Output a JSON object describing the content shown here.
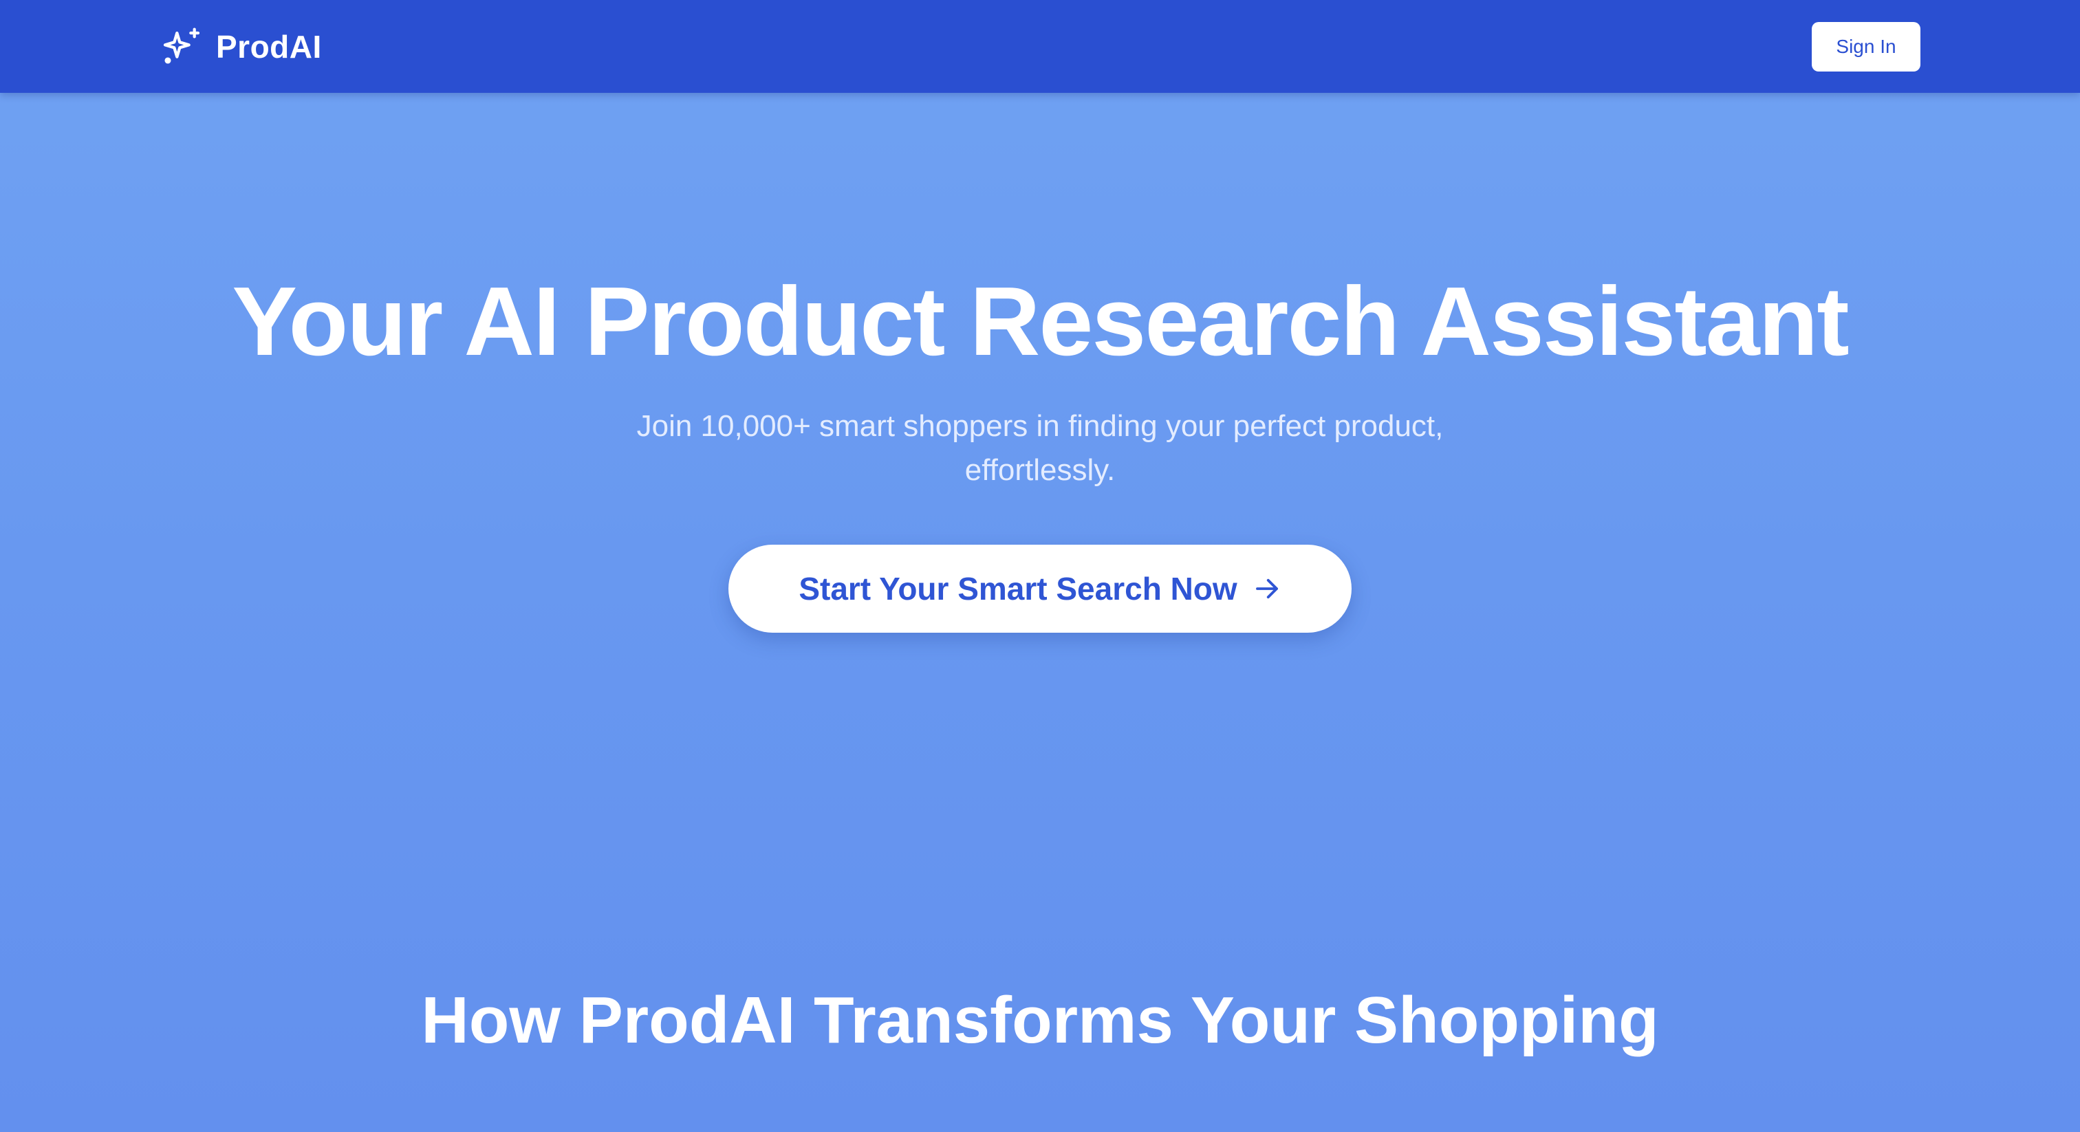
{
  "navbar": {
    "brand_icon": "sparkles-icon",
    "brand_name": "ProdAI",
    "signin_label": "Sign In",
    "background_color": "#2a4fd1"
  },
  "hero": {
    "title": "Your AI Product Research Assistant",
    "subtitle_line1": "Join 10,000+ smart shoppers in finding your perfect product,",
    "subtitle_line2": "effortlessly.",
    "cta_label": "Start Your Smart Search Now",
    "cta_icon": "arrow-right-icon"
  },
  "features": {
    "title": "How ProdAI Transforms Your Shopping"
  },
  "colors": {
    "accent": "#2f55d4",
    "background_top": "#70a2f3",
    "background_bottom": "#6390ee"
  }
}
